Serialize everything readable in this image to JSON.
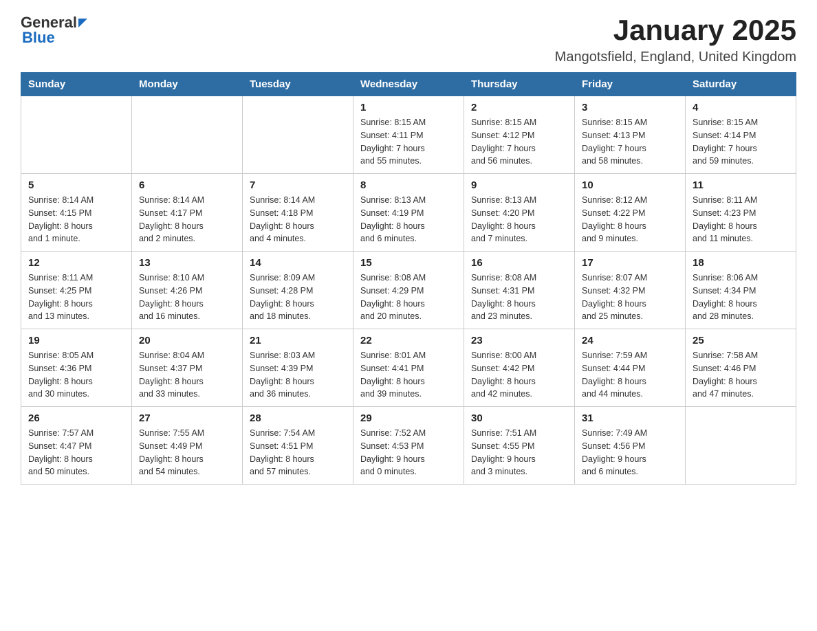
{
  "header": {
    "logo_general": "General",
    "logo_blue": "Blue",
    "title": "January 2025",
    "subtitle": "Mangotsfield, England, United Kingdom"
  },
  "days_of_week": [
    "Sunday",
    "Monday",
    "Tuesday",
    "Wednesday",
    "Thursday",
    "Friday",
    "Saturday"
  ],
  "weeks": [
    [
      {
        "day": "",
        "info": ""
      },
      {
        "day": "",
        "info": ""
      },
      {
        "day": "",
        "info": ""
      },
      {
        "day": "1",
        "info": "Sunrise: 8:15 AM\nSunset: 4:11 PM\nDaylight: 7 hours\nand 55 minutes."
      },
      {
        "day": "2",
        "info": "Sunrise: 8:15 AM\nSunset: 4:12 PM\nDaylight: 7 hours\nand 56 minutes."
      },
      {
        "day": "3",
        "info": "Sunrise: 8:15 AM\nSunset: 4:13 PM\nDaylight: 7 hours\nand 58 minutes."
      },
      {
        "day": "4",
        "info": "Sunrise: 8:15 AM\nSunset: 4:14 PM\nDaylight: 7 hours\nand 59 minutes."
      }
    ],
    [
      {
        "day": "5",
        "info": "Sunrise: 8:14 AM\nSunset: 4:15 PM\nDaylight: 8 hours\nand 1 minute."
      },
      {
        "day": "6",
        "info": "Sunrise: 8:14 AM\nSunset: 4:17 PM\nDaylight: 8 hours\nand 2 minutes."
      },
      {
        "day": "7",
        "info": "Sunrise: 8:14 AM\nSunset: 4:18 PM\nDaylight: 8 hours\nand 4 minutes."
      },
      {
        "day": "8",
        "info": "Sunrise: 8:13 AM\nSunset: 4:19 PM\nDaylight: 8 hours\nand 6 minutes."
      },
      {
        "day": "9",
        "info": "Sunrise: 8:13 AM\nSunset: 4:20 PM\nDaylight: 8 hours\nand 7 minutes."
      },
      {
        "day": "10",
        "info": "Sunrise: 8:12 AM\nSunset: 4:22 PM\nDaylight: 8 hours\nand 9 minutes."
      },
      {
        "day": "11",
        "info": "Sunrise: 8:11 AM\nSunset: 4:23 PM\nDaylight: 8 hours\nand 11 minutes."
      }
    ],
    [
      {
        "day": "12",
        "info": "Sunrise: 8:11 AM\nSunset: 4:25 PM\nDaylight: 8 hours\nand 13 minutes."
      },
      {
        "day": "13",
        "info": "Sunrise: 8:10 AM\nSunset: 4:26 PM\nDaylight: 8 hours\nand 16 minutes."
      },
      {
        "day": "14",
        "info": "Sunrise: 8:09 AM\nSunset: 4:28 PM\nDaylight: 8 hours\nand 18 minutes."
      },
      {
        "day": "15",
        "info": "Sunrise: 8:08 AM\nSunset: 4:29 PM\nDaylight: 8 hours\nand 20 minutes."
      },
      {
        "day": "16",
        "info": "Sunrise: 8:08 AM\nSunset: 4:31 PM\nDaylight: 8 hours\nand 23 minutes."
      },
      {
        "day": "17",
        "info": "Sunrise: 8:07 AM\nSunset: 4:32 PM\nDaylight: 8 hours\nand 25 minutes."
      },
      {
        "day": "18",
        "info": "Sunrise: 8:06 AM\nSunset: 4:34 PM\nDaylight: 8 hours\nand 28 minutes."
      }
    ],
    [
      {
        "day": "19",
        "info": "Sunrise: 8:05 AM\nSunset: 4:36 PM\nDaylight: 8 hours\nand 30 minutes."
      },
      {
        "day": "20",
        "info": "Sunrise: 8:04 AM\nSunset: 4:37 PM\nDaylight: 8 hours\nand 33 minutes."
      },
      {
        "day": "21",
        "info": "Sunrise: 8:03 AM\nSunset: 4:39 PM\nDaylight: 8 hours\nand 36 minutes."
      },
      {
        "day": "22",
        "info": "Sunrise: 8:01 AM\nSunset: 4:41 PM\nDaylight: 8 hours\nand 39 minutes."
      },
      {
        "day": "23",
        "info": "Sunrise: 8:00 AM\nSunset: 4:42 PM\nDaylight: 8 hours\nand 42 minutes."
      },
      {
        "day": "24",
        "info": "Sunrise: 7:59 AM\nSunset: 4:44 PM\nDaylight: 8 hours\nand 44 minutes."
      },
      {
        "day": "25",
        "info": "Sunrise: 7:58 AM\nSunset: 4:46 PM\nDaylight: 8 hours\nand 47 minutes."
      }
    ],
    [
      {
        "day": "26",
        "info": "Sunrise: 7:57 AM\nSunset: 4:47 PM\nDaylight: 8 hours\nand 50 minutes."
      },
      {
        "day": "27",
        "info": "Sunrise: 7:55 AM\nSunset: 4:49 PM\nDaylight: 8 hours\nand 54 minutes."
      },
      {
        "day": "28",
        "info": "Sunrise: 7:54 AM\nSunset: 4:51 PM\nDaylight: 8 hours\nand 57 minutes."
      },
      {
        "day": "29",
        "info": "Sunrise: 7:52 AM\nSunset: 4:53 PM\nDaylight: 9 hours\nand 0 minutes."
      },
      {
        "day": "30",
        "info": "Sunrise: 7:51 AM\nSunset: 4:55 PM\nDaylight: 9 hours\nand 3 minutes."
      },
      {
        "day": "31",
        "info": "Sunrise: 7:49 AM\nSunset: 4:56 PM\nDaylight: 9 hours\nand 6 minutes."
      },
      {
        "day": "",
        "info": ""
      }
    ]
  ]
}
